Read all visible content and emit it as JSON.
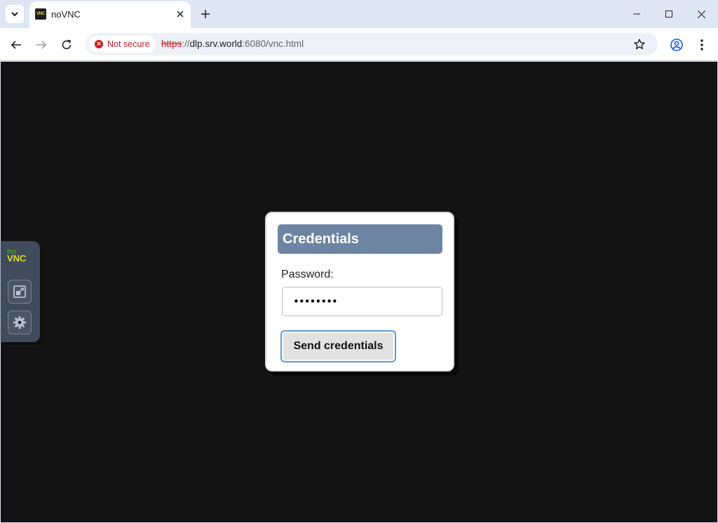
{
  "browser": {
    "tab_title": "noVNC",
    "favicon_text": "VNC",
    "security_label": "Not secure",
    "url_scheme": "https",
    "url_sep": "://",
    "url_host": "dlp.srv.world",
    "url_path": ":6080/vnc.html"
  },
  "novnc": {
    "logo_no": "no",
    "logo_vnc": "VNC"
  },
  "dialog": {
    "title": "Credentials",
    "password_label": "Password:",
    "password_value": "••••••••",
    "send_label": "Send credentials"
  },
  "colors": {
    "accent": "#6e84a3",
    "background": "#131313",
    "insecure": "#c5221f",
    "focus": "#5b9bd5"
  }
}
